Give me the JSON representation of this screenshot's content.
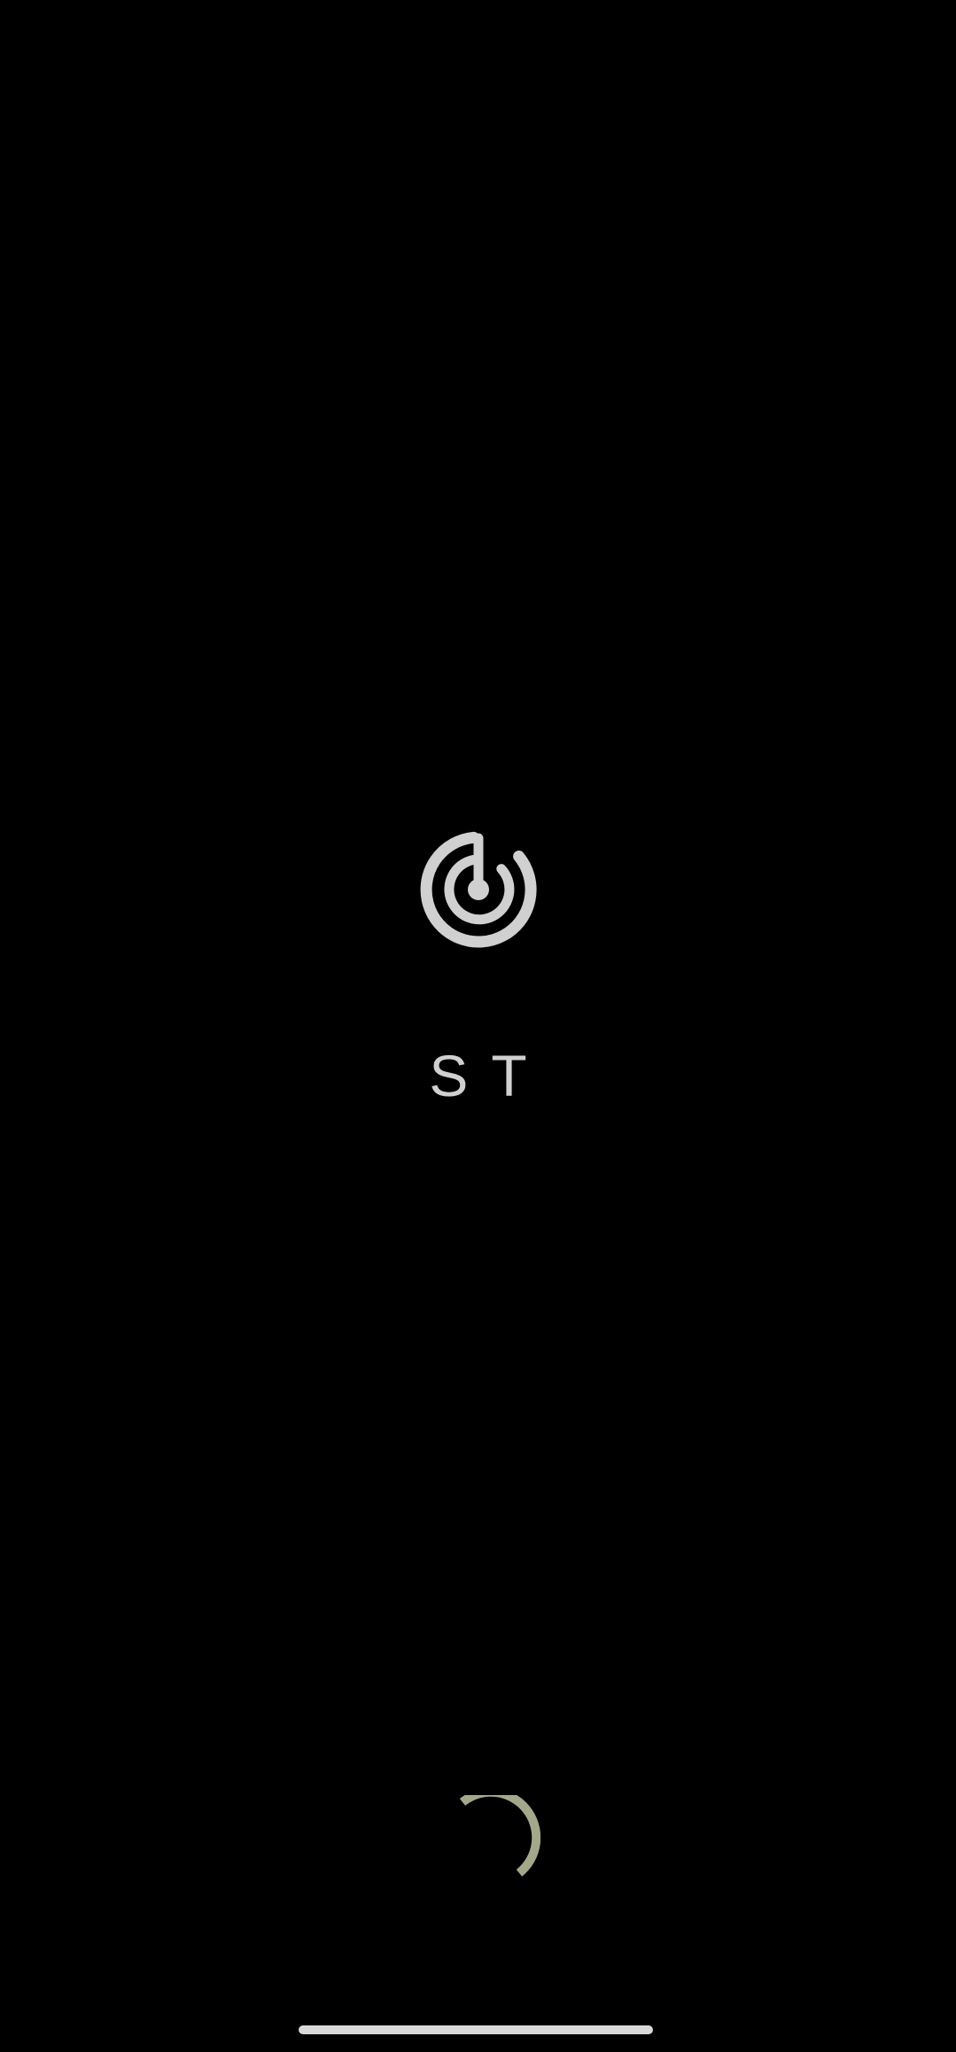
{
  "app": {
    "title": "ST",
    "logo_icon": "radar-power-logo-icon",
    "logo_color": "#d0d0d0"
  },
  "loading": {
    "icon": "loading-spinner-icon",
    "color": "#a3a88a"
  },
  "system": {
    "home_indicator_color": "#d8d8d8"
  }
}
